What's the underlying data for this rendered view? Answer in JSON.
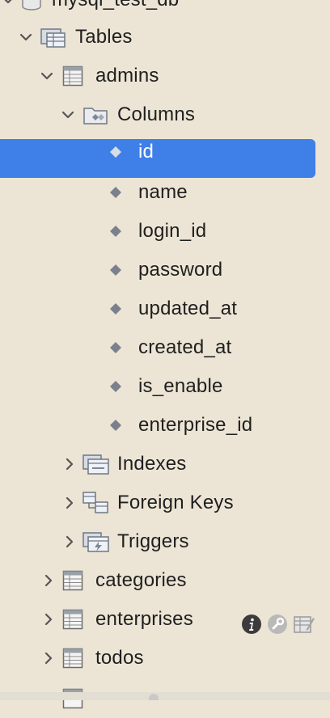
{
  "tree": {
    "database_label": "mysql_test_db",
    "tables_label": "Tables",
    "tables": [
      {
        "name": "admins"
      },
      {
        "name": "categories"
      },
      {
        "name": "enterprises"
      },
      {
        "name": "todos"
      }
    ],
    "columns_label": "Columns",
    "columns": [
      "id",
      "name",
      "login_id",
      "password",
      "updated_at",
      "created_at",
      "is_enable",
      "enterprise_id"
    ],
    "indexes_label": "Indexes",
    "foreign_keys_label": "Foreign Keys",
    "triggers_label": "Triggers",
    "selected_column": "id"
  },
  "icons": {
    "database": "database-icon",
    "tables": "tables-folder-icon",
    "table": "table-icon",
    "columns": "columns-folder-icon",
    "column": "column-diamond-icon",
    "indexes": "indexes-folder-icon",
    "foreign_keys": "foreign-keys-folder-icon",
    "triggers": "triggers-folder-icon",
    "info": "info-icon",
    "tool": "wrench-icon",
    "edit": "edit-table-icon"
  },
  "colors": {
    "background": "#ece5d5",
    "selection": "#3f7fe8"
  }
}
